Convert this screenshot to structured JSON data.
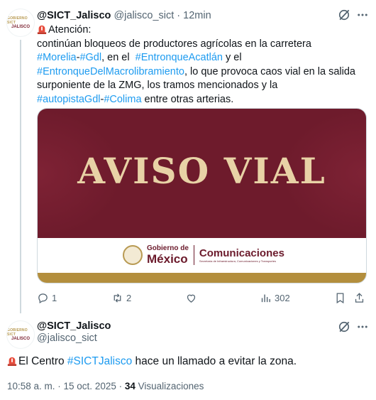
{
  "tweet1": {
    "avatar_line1": "GOBIERNO SICT",
    "avatar_line2": "JALISCO",
    "name": "@SICT_Jalisco",
    "handle": "@jalisco_sict",
    "separator": "·",
    "time": "12min",
    "body": {
      "line1": "Atención:",
      "line2": "continúan bloqueos de productores agrícolas en la carretera",
      "tag_morelia": "#Morelia",
      "dash1": "-",
      "tag_gdl": "#Gdl",
      "text_en_el": ", en el ",
      "tag_acatlan": "#EntronqueAcatlán",
      "text_y_el": " y el",
      "tag_macro": "#EntronqueDelMacrolibramiento",
      "text_caos": ", lo que provoca caos vial en la salida",
      "line5": "surponiente de la ZMG, los tramos mencionados y la",
      "tag_autopista": "#autopistaGdl",
      "dash2": "-",
      "tag_colima": "#Colima",
      "text_end": " entre otras arterias."
    },
    "media": {
      "headline": "AVISO VIAL",
      "gob_small": "Gobierno de",
      "gob_big": "México",
      "dept_big": "Comunicaciones",
      "dept_small": "Secretaría de Infraestructura, Comunicaciones y Transportes"
    },
    "actions": {
      "replies": "1",
      "reposts": "2",
      "views": "302"
    }
  },
  "tweet2": {
    "avatar_line1": "GOBIERNO SICT",
    "avatar_line2": "JALISCO",
    "name": "@SICT_Jalisco",
    "handle": "@jalisco_sict",
    "body_pre": "El Centro ",
    "body_tag": "#SICTJalisco",
    "body_post": " hace un llamado a evitar la zona.",
    "timestamp": "10:58 a. m. · 15 oct. 2025 · ",
    "views_count": "34",
    "views_label": " Visualizaciones"
  },
  "colors": {
    "link": "#1d9bf0",
    "text": "#0f1419",
    "muted": "#536471",
    "maroon": "#6e1b2c",
    "gold": "#b38e3d"
  },
  "icons": [
    "siren-icon",
    "grok-icon",
    "more-icon",
    "reply-icon",
    "repost-icon",
    "like-icon",
    "views-icon",
    "bookmark-icon",
    "share-icon"
  ]
}
